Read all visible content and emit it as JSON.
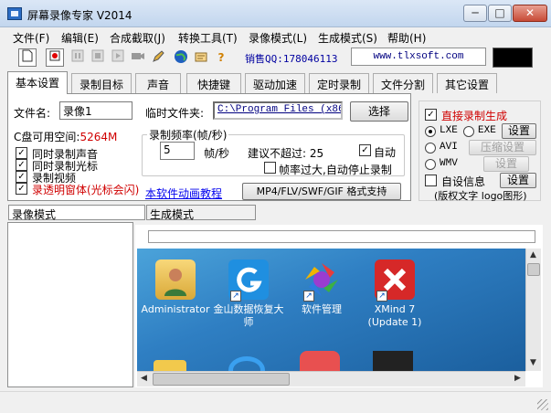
{
  "window": {
    "title": "屏幕录像专家 V2014"
  },
  "menu": [
    "文件(F)",
    "编辑(E)",
    "合成截取(J)",
    "转换工具(T)",
    "录像模式(L)",
    "生成模式(S)",
    "帮助(H)"
  ],
  "toolbar": {
    "icons": [
      "new-file-icon",
      "record-icon",
      "pause-icon",
      "stop-icon",
      "play-icon",
      "camera-icon",
      "pen-icon",
      "globe-icon",
      "hand-icon",
      "help-icon"
    ],
    "help_glyph": "?",
    "qq": "销售QQ:178046113",
    "url": "www.tlxsoft.com"
  },
  "tabs": [
    "基本设置",
    "录制目标",
    "声音",
    "快捷键",
    "驱动加速",
    "定时录制",
    "文件分割",
    "其它设置"
  ],
  "basic": {
    "filename_label": "文件名:",
    "filename_value": "录像1",
    "tempdir_label": "临时文件夹:",
    "tempdir_value": "C:\\Program Files (x86)\\",
    "browse_button": "选择",
    "disk_label": "C盘可用空间:",
    "disk_value": "5264M",
    "checks": [
      {
        "label": "同时录制声音",
        "checked": true,
        "red": false
      },
      {
        "label": "同时录制光标",
        "checked": true,
        "red": false
      },
      {
        "label": "录制视频",
        "checked": true,
        "red": false
      },
      {
        "label": "录透明窗体(光标会闪)",
        "checked": true,
        "red": true
      }
    ],
    "framerate_group": "录制频率(帧/秒)",
    "framerate_value": "5",
    "framerate_unit": "帧/秒",
    "suggest_label": "建议不超过: 25",
    "auto_label": "自动",
    "auto_checked": true,
    "autostop_label": "帧率过大,自动停止录制",
    "autostop_checked": false,
    "tutorial_link": "本软件动画教程",
    "format_button": "MP4/FLV/SWF/GIF  格式支持"
  },
  "right": {
    "direct_label": "直接录制生成",
    "direct_checked": true,
    "options": [
      {
        "label": "LXE",
        "on": true
      },
      {
        "label": "EXE",
        "on": false
      },
      {
        "label": "AVI",
        "on": false
      },
      {
        "label": "WMV",
        "on": false
      }
    ],
    "setting_button": "设置",
    "compress_button": "压缩设置",
    "setting2_button": "设置",
    "custom_info_label": "自设信息",
    "custom_info_checked": false,
    "setting3_button": "设置",
    "copyright_label": "(版权文字 logo图形)"
  },
  "modes": [
    "录像模式",
    "生成模式"
  ],
  "desktop_icons": [
    {
      "label": "Administrator",
      "icon": "user-folder-icon",
      "shortcut": false
    },
    {
      "label": "金山数据恢复大师",
      "icon": "recovery-icon",
      "shortcut": true
    },
    {
      "label": "软件管理",
      "icon": "software-manager-icon",
      "shortcut": true
    },
    {
      "label": "XMind 7 (Update 1)",
      "icon": "xmind-icon",
      "shortcut": true
    }
  ],
  "scroll_glyphs": {
    "up": "▲",
    "down": "▼",
    "left": "◀",
    "right": "▶"
  },
  "shortcut_glyph": "↗",
  "window_controls": {
    "min": "─",
    "max": "□",
    "close": "✕"
  },
  "colors": {
    "accent_red": "#d00000",
    "link_blue": "#0000ee",
    "desktop_blue": "#2f7fc3"
  }
}
